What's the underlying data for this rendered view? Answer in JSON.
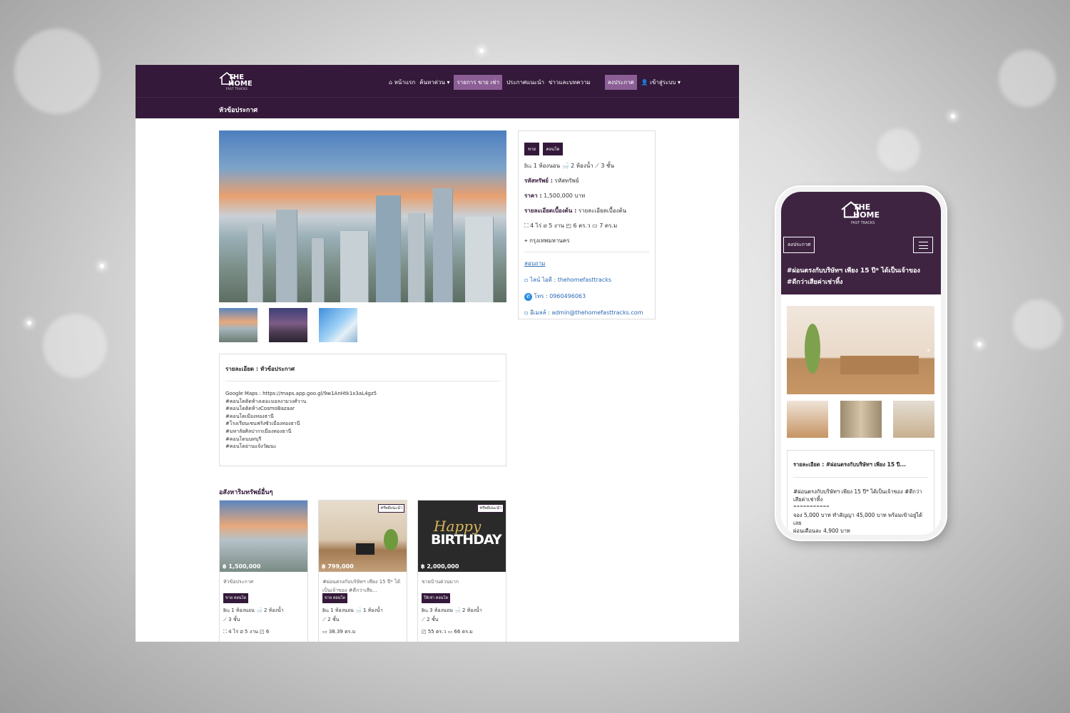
{
  "nav": {
    "home": "หน้าแรก",
    "search": "ค้นหาด่วน",
    "listing": "รายการ ขาย เช่า",
    "recommended": "ประกาศแนะนำ",
    "news": "ข่าวและบทความ",
    "post": "ลงประกาศ",
    "login": "เข้าสู่ระบบ"
  },
  "logo": {
    "title": "THE HOME",
    "sub": "FAST TRACKS"
  },
  "page": {
    "heading": "หัวข้อประกาศ"
  },
  "side": {
    "tags": [
      "ขาย",
      "คอนโด"
    ],
    "rooms": "1 ห้องนอน",
    "baths": "2 ห้องน้ำ",
    "floors": "3 ชั้น",
    "code_label": "รหัสทรัพย์ :",
    "code": "รหัสทรัพย์",
    "price_label": "ราคา :",
    "price": "1,500,000 บาท",
    "brief_label": "รายละเอียดเบื้องต้น :",
    "brief": "รายละเอียดเบื้องต้น",
    "rai": "4 ไร่",
    "ngan": "5 งาน",
    "wa": "6 ตร.ว",
    "sqm": "7 ตร.ม",
    "location": "กรุงเทพมหานคร",
    "inquiry": "สอบถาม",
    "line": "ไลน์ ไอดี : thehomefasttracks",
    "phone": "โทร : 0960496063",
    "email": "อีเมลล์ : admin@thehomefasttracks.com"
  },
  "desc": {
    "title": "รายละเอียด : หัวข้อประกาศ",
    "lines": [
      "Google Maps : https://maps.app.goo.gl/9w1AnHtk1x3aL4gz5",
      "#คอนโดติดห้างเดอะมอลงามวงศ์วาน",
      "#คอนโดติดห้างCosmoBazaar",
      "#คอนโดเมืองทองธานี",
      "#โรงเรียนเซนฟรังซัวเมืองทองธานี",
      "#มหาลัยศิลปากรเมืองทองธานี",
      "#คอนโดนนทบุรี",
      "#คอนโดย่านแจ้งวัฒนะ"
    ]
  },
  "other": {
    "title": "อสังหาริมทรัพย์อื่นๆ"
  },
  "cards": [
    {
      "price": "฿ 1,500,000",
      "title": "หัวข้อประกาศ",
      "tag": "ขาย คอนโด",
      "rooms": "1 ห้องนอน",
      "baths": "2 ห้องน้ำ",
      "floors": "3 ชั้น",
      "land": "4 ไร่",
      "ngan": "5 งาน",
      "wa": "6",
      "badge": ""
    },
    {
      "price": "฿ 799,000",
      "title": "#ผ่อนตรงกับบริษัทฯ เพียง 15 ปี* ได้เป็นเจ้าของ #ดีกว่าเสีย...",
      "tag": "ขาย คอนโด",
      "rooms": "1 ห้องนอน",
      "baths": "1 ห้องน้ำ",
      "floors": "2 ชั้น",
      "land": "38.39 ตร.ม",
      "ngan": "",
      "wa": "",
      "badge": "ทรัพย์แนะนำ"
    },
    {
      "price": "฿ 2,000,000",
      "title": "ขายบ้านด่วนมาก",
      "tag": "ให้เช่า คอนโด",
      "rooms": "3 ห้องนอน",
      "baths": "2 ห้องน้ำ",
      "floors": "2 ชั้น",
      "land": "55 ตร.ว",
      "ngan": "66 ตร.ม",
      "wa": "",
      "badge": "ทรัพย์แนะนำ"
    }
  ],
  "birthday": {
    "script": "Happy",
    "text": "BIRTHDAY"
  },
  "mobile": {
    "post": "ลงประกาศ",
    "title": "#ผ่อนตรงกับบริษัทฯ เพียง 15 ปี* ได้เป็นเจ้าของ #ดีกว่าเสียค่าเช่าทิ้ง",
    "desc_title": "รายละเอียด : #ผ่อนตรงกับบริษัทฯ เพียง 15 ปี...",
    "desc_lines": [
      "#ผ่อนตรงกับบริษัทฯ เพียง 15 ปี* ได้เป็นเจ้าของ #ดีกว่าเสียค่าเช่าทิ้ง",
      "===========",
      "จอง 5,000 บาท ทำสัญญา 45,000 บาท พร้อมเข้าอยู่ได้เลย",
      "ผ่อนเดือนละ 4,900 บาท"
    ]
  },
  "colors": {
    "brand": "#34193a",
    "accent": "#8b5f96",
    "link": "#2a6ab5"
  }
}
